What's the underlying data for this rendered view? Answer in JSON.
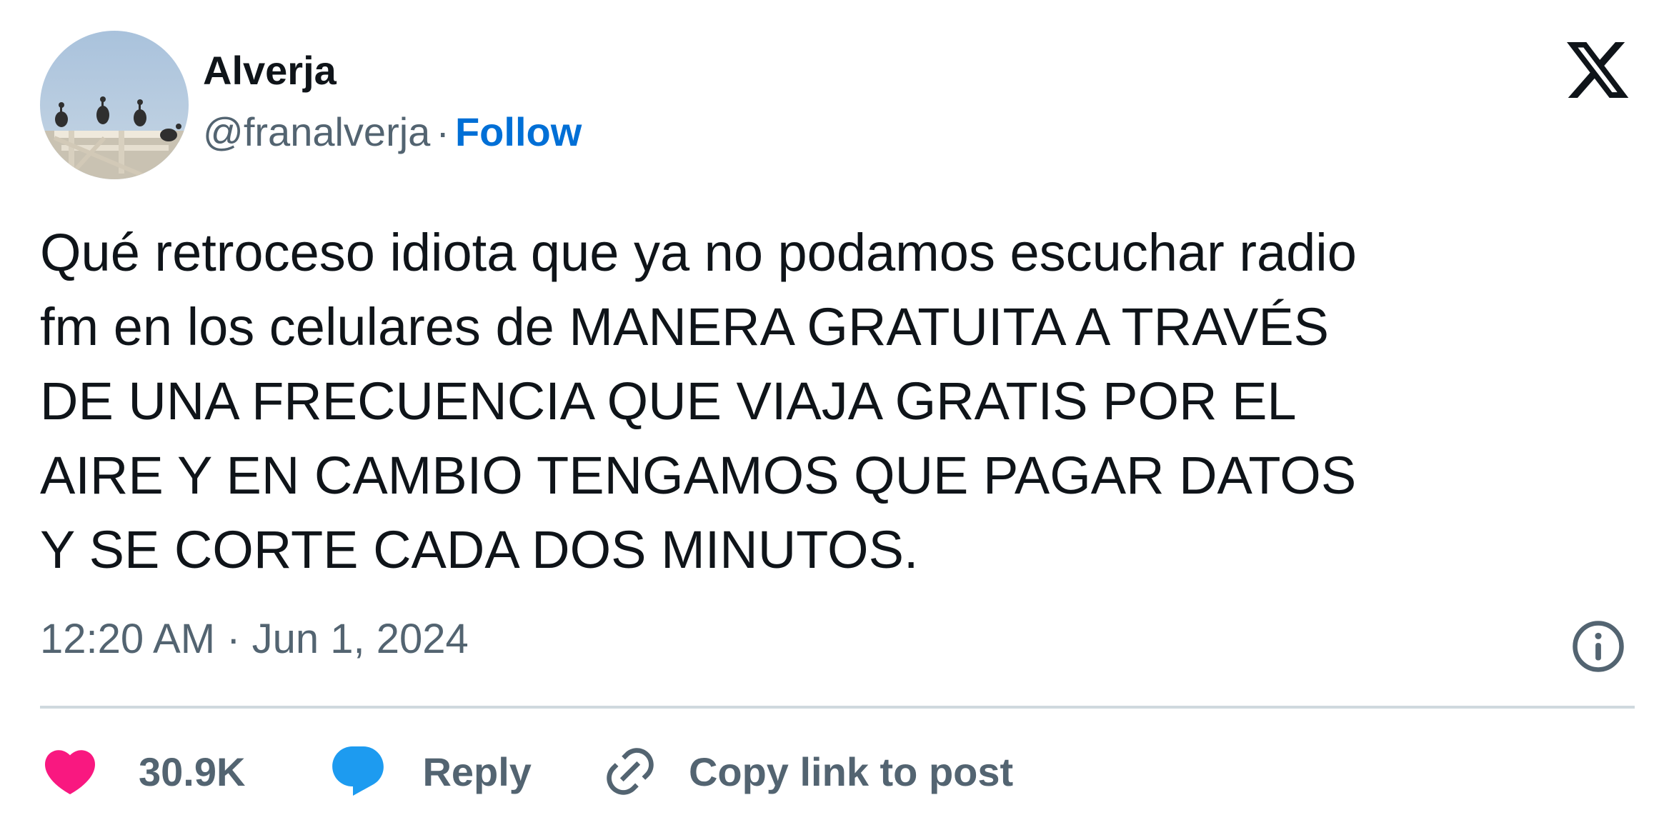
{
  "author": {
    "display_name": "Alverja",
    "handle": "@franalverja",
    "separator": "·",
    "follow_label": "Follow"
  },
  "tweet": {
    "text": "Qué retroceso idiota que ya no podamos escuchar radio\nfm en los celulares de MANERA GRATUITA A TRAVÉS\nDE UNA FRECUENCIA QUE VIAJA GRATIS POR EL\nAIRE Y EN CAMBIO TENGAMOS QUE PAGAR DATOS\nY SE CORTE CADA DOS MINUTOS.",
    "timestamp": "12:20 AM · Jun 1, 2024"
  },
  "actions": {
    "likes_count": "30.9K",
    "reply_label": "Reply",
    "copy_link_label": "Copy link to post"
  },
  "icons": {
    "brand": "x-logo-icon",
    "info": "info-icon",
    "like": "heart-icon",
    "reply": "speech-bubble-icon",
    "copy": "link-icon"
  },
  "colors": {
    "text": "#0f1419",
    "secondary": "#536471",
    "follow": "#006fd6",
    "heart": "#f91880",
    "reply": "#1d9bf0",
    "divider": "#cfd9de"
  }
}
